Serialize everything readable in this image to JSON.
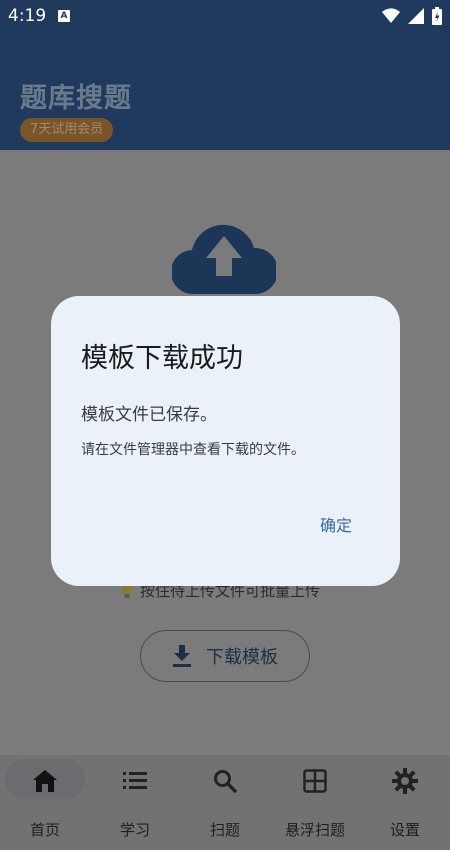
{
  "status_bar": {
    "time": "4:19",
    "notification_icon": "A"
  },
  "app_bar": {
    "title": "题库搜题",
    "badge": "7天试用会员"
  },
  "content": {
    "tip": "按住待上传文件可批量上传",
    "download_button": "下载模板"
  },
  "dialog": {
    "title": "模板下载成功",
    "message1": "模板文件已保存。",
    "message2": "请在文件管理器中查看下载的文件。",
    "confirm": "确定"
  },
  "bottom_nav": {
    "items": [
      {
        "label": "首页",
        "icon": "home-icon",
        "active": true
      },
      {
        "label": "学习",
        "icon": "list-icon",
        "active": false
      },
      {
        "label": "扫题",
        "icon": "search-icon",
        "active": false
      },
      {
        "label": "悬浮扫题",
        "icon": "grid-icon",
        "active": false
      },
      {
        "label": "设置",
        "icon": "gear-icon",
        "active": false
      }
    ]
  },
  "colors": {
    "primary": "#1f3a5c",
    "dialog_bg": "#eaf1f9",
    "accent": "#3b6aa0"
  }
}
